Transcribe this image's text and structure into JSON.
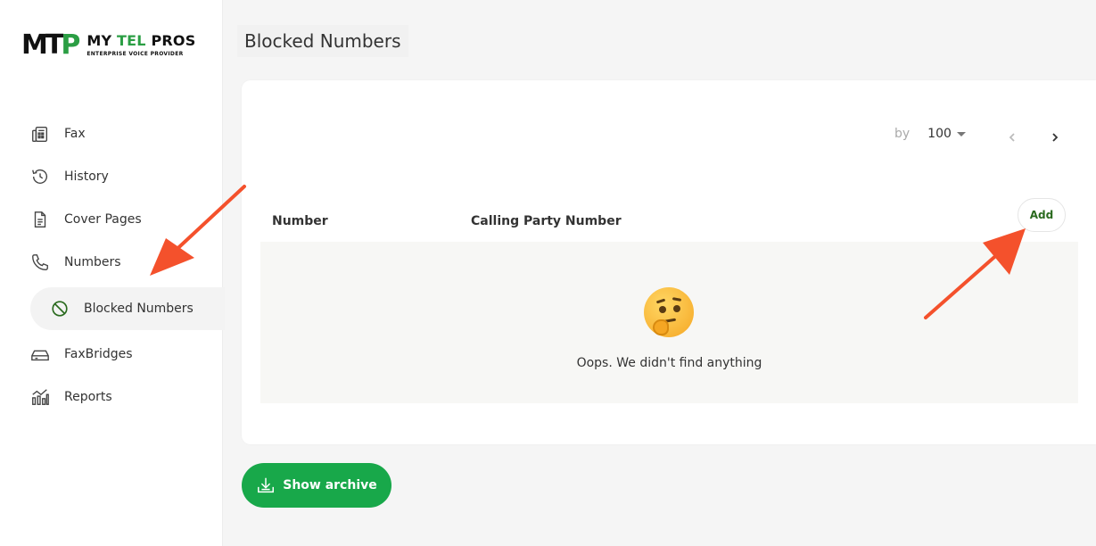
{
  "brand": {
    "mark_m": "M",
    "mark_t": "T",
    "mark_p": "P",
    "name_my": "MY",
    "name_tel": "TEL",
    "name_pros": "PROS",
    "tagline": "ENTERPRISE VOICE PROVIDER"
  },
  "sidebar": {
    "items": [
      {
        "label": "Fax",
        "icon": "fax-icon"
      },
      {
        "label": "History",
        "icon": "history-icon"
      },
      {
        "label": "Cover Pages",
        "icon": "document-icon"
      },
      {
        "label": "Numbers",
        "icon": "phone-icon"
      },
      {
        "label": "Blocked Numbers",
        "icon": "blocked-icon",
        "active": true
      },
      {
        "label": "FaxBridges",
        "icon": "drive-icon"
      },
      {
        "label": "Reports",
        "icon": "reports-icon"
      }
    ]
  },
  "page": {
    "title": "Blocked Numbers"
  },
  "pagination": {
    "by_label": "by",
    "per_page": "100"
  },
  "table": {
    "columns": [
      "Number",
      "Calling Party Number"
    ],
    "add_label": "Add",
    "empty_text": "Oops. We didn't find anything"
  },
  "archive": {
    "label": "Show archive"
  },
  "colors": {
    "accent_green": "#18a84a",
    "annotation_arrow": "#f4512c"
  }
}
